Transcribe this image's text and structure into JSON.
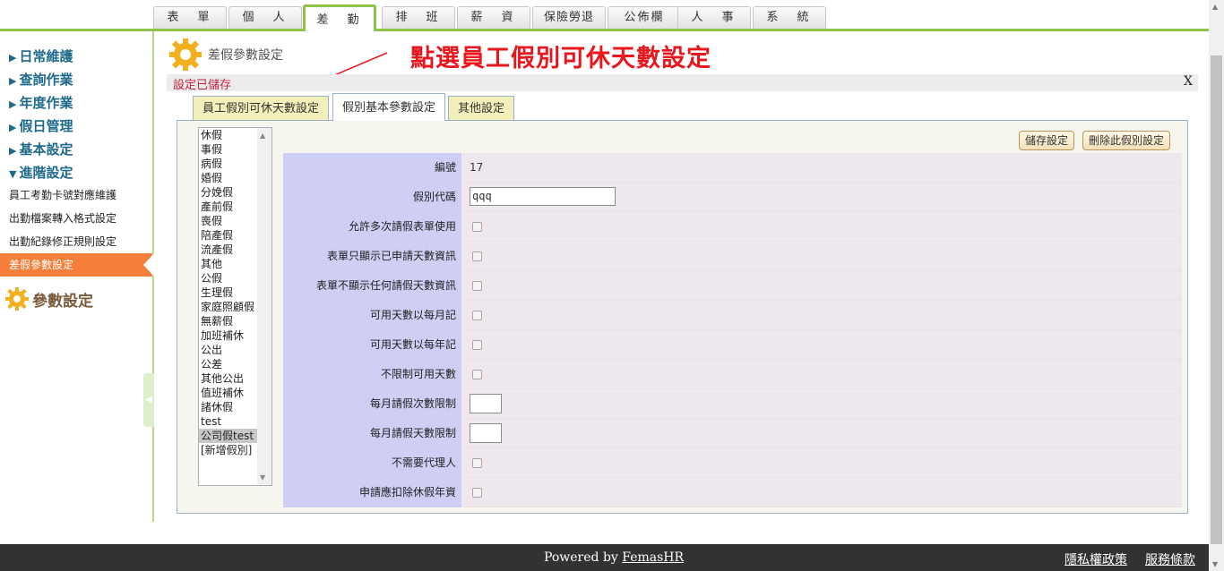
{
  "top_tabs": [
    "表　單",
    "個　人",
    "差　勤",
    "排　班",
    "薪　資",
    "保險勞退",
    "公佈欄",
    "人　事",
    "系　統"
  ],
  "sidebar": {
    "menus": [
      "日常維護",
      "查詢作業",
      "年度作業",
      "假日管理",
      "基本設定",
      "進階設定"
    ],
    "sub_items": [
      "員工考勤卡號對應維護",
      "出勤檔案轉入格式設定",
      "出勤紀錄修正規則設定",
      "差假參數設定"
    ],
    "param_title": "參數設定"
  },
  "page": {
    "title": "差假參數設定",
    "annotation": "點選員工假別可休天數設定",
    "notice": "設定已儲存",
    "close": "X"
  },
  "sub_tabs": [
    "員工假別可休天數設定",
    "假別基本參數設定",
    "其他設定"
  ],
  "leave_types": [
    "休假",
    "事假",
    "病假",
    "婚假",
    "分娩假",
    "產前假",
    "喪假",
    "陪產假",
    "流產假",
    "其他",
    "公假",
    "生理假",
    "家庭照顧假",
    "無薪假",
    "加班補休",
    "公出",
    "公差",
    "其他公出",
    "值班補休",
    "諸休假",
    "test",
    "公司假test",
    "[新增假別]"
  ],
  "selected_leave": "公司假test",
  "buttons": {
    "save": "儲存設定",
    "delete": "刪除此假別設定"
  },
  "form": {
    "id_label": "編號",
    "id_value": "17",
    "code_label": "假別代碼",
    "code_value": "qqq",
    "checkboxes": [
      "允許多次請假表單使用",
      "表單只顯示已申請天數資訊",
      "表單不顯示任何請假天數資訊",
      "可用天數以每月記",
      "可用天數以每年記",
      "不限制可用天數"
    ],
    "monthly_times_label": "每月請假次數限制",
    "monthly_times_value": "",
    "monthly_days_label": "每月請假天數限制",
    "monthly_days_value": "",
    "checkboxes_2": [
      "不需要代理人",
      "申請應扣除休假年資"
    ]
  },
  "footer": {
    "powered_prefix": "Powered by ",
    "powered_link": "FemasHR",
    "privacy": "隱私權政策",
    "terms": "服務條款"
  },
  "colors": {
    "accent_green": "#8fc34a",
    "active_orange": "#f57f3a",
    "label_bg": "#cfcff6",
    "annotation_red": "#e8171e"
  }
}
